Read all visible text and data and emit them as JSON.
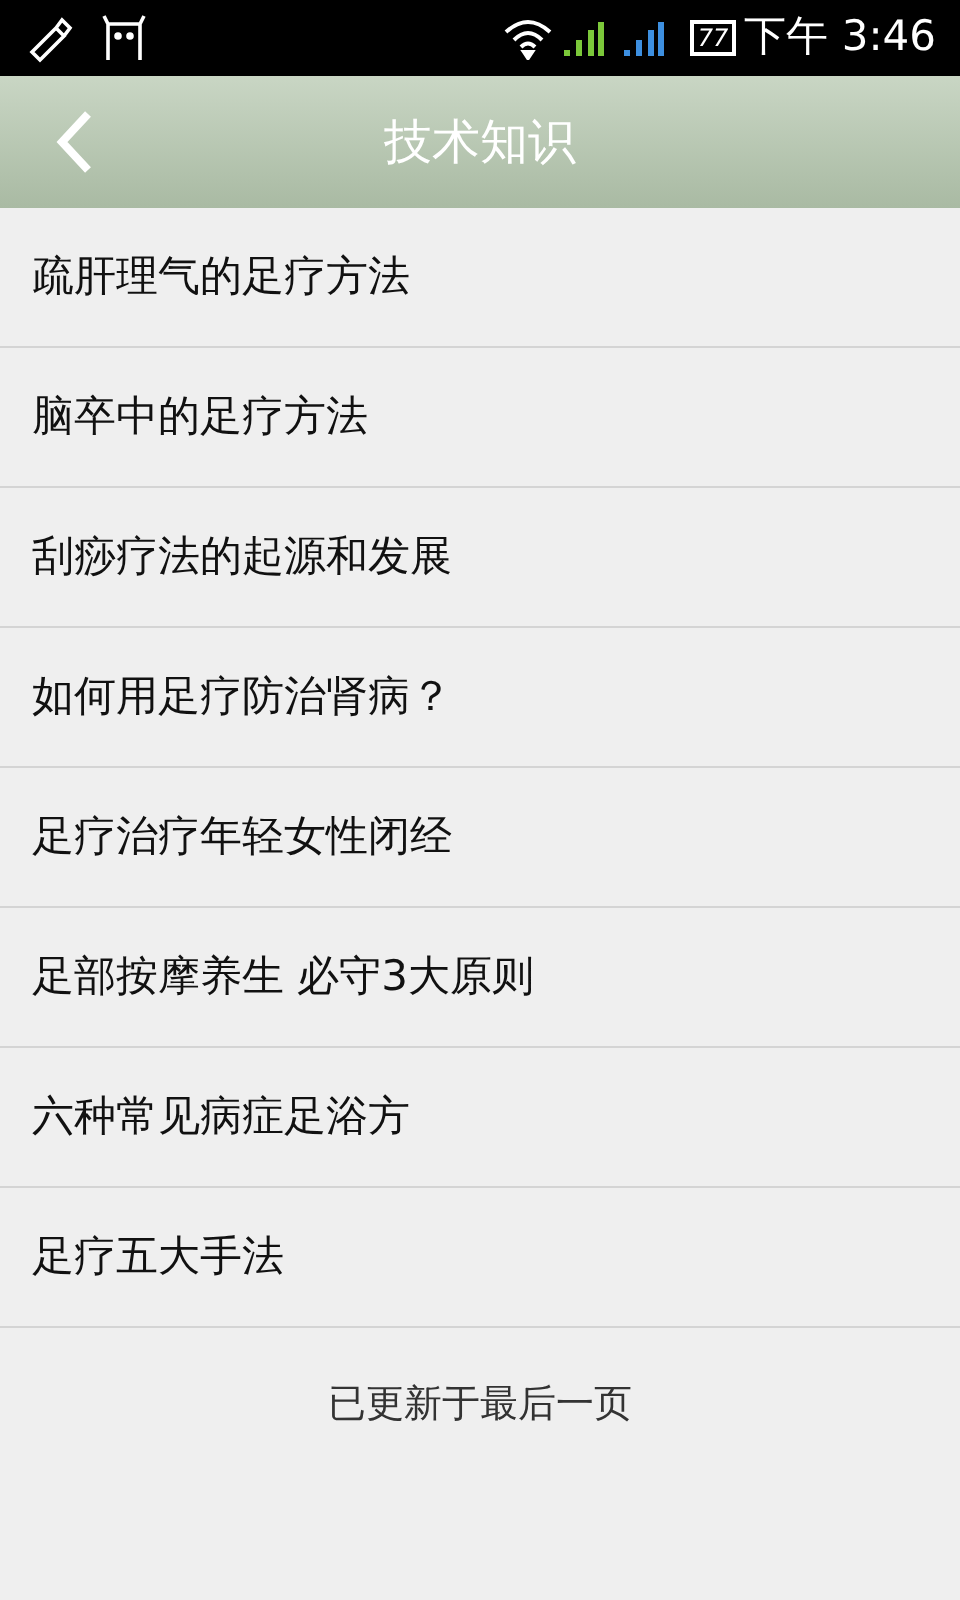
{
  "status_bar": {
    "battery": "77",
    "time": "下午 3:46"
  },
  "header": {
    "title": "技术知识"
  },
  "items": [
    {
      "title": "疏肝理气的足疗方法"
    },
    {
      "title": "脑卒中的足疗方法"
    },
    {
      "title": "刮痧疗法的起源和发展"
    },
    {
      "title": "如何用足疗防治肾病？"
    },
    {
      "title": "足疗治疗年轻女性闭经"
    },
    {
      "title": "足部按摩养生 必守3大原则"
    },
    {
      "title": "六种常见病症足浴方"
    },
    {
      "title": "足疗五大手法"
    }
  ],
  "footer": "已更新于最后一页"
}
